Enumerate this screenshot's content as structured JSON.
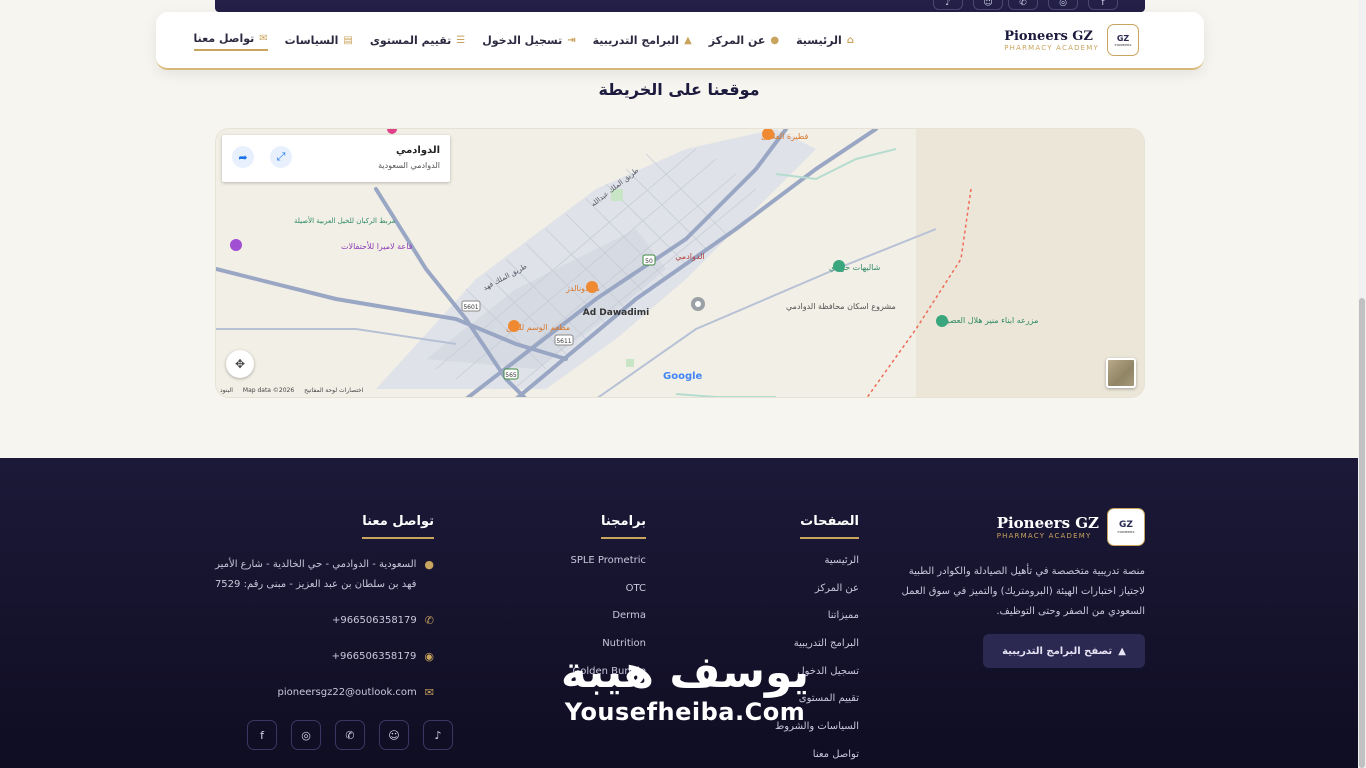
{
  "top_bar": {
    "socials": [
      {
        "icon": "facebook-icon",
        "glyph": "f"
      },
      {
        "icon": "instagram-icon",
        "glyph": "◎"
      },
      {
        "icon": "whatsapp-icon",
        "glyph": "✆"
      },
      {
        "icon": "snapchat-icon",
        "glyph": "☺"
      },
      {
        "icon": "tiktok-icon",
        "glyph": "♪"
      }
    ]
  },
  "brand": {
    "name": "Pioneers GZ",
    "subtitle": "PHARMACY ACADEMY",
    "logo_text": "GZ",
    "logo_sub": "PIONEERS"
  },
  "nav": [
    {
      "label": "الرئيسية",
      "icon": "home-icon",
      "glyph": "⌂"
    },
    {
      "label": "عن المركز",
      "icon": "info-icon",
      "glyph": "ⓘ"
    },
    {
      "label": "البرامج التدريبية",
      "icon": "graduation-cap-icon",
      "glyph": "🎓"
    },
    {
      "label": "تسجيل الدخول",
      "icon": "login-icon",
      "glyph": "⇥"
    },
    {
      "label": "تقييم المستوى",
      "icon": "checklist-icon",
      "glyph": "☷"
    },
    {
      "label": "السياسات",
      "icon": "file-icon",
      "glyph": "▤"
    },
    {
      "label": "تواصل معنا",
      "icon": "envelope-icon",
      "glyph": "✉",
      "active": true
    }
  ],
  "map_section": {
    "title": "موقعنا على الخريطة",
    "card_title": "الدوادمي",
    "card_subtitle": "الدوادمي السعودية",
    "labels": {
      "ad_dawadimi": "Ad Dawadimi",
      "dawadimi_ar": "الدوادمي",
      "mcdonalds": "ماكدونالدز",
      "falafel": "فطيرة الفلافل",
      "wasm": "مطعم الوسم للمتن",
      "housing": "مشروع اسكان محافظة الدوادمي",
      "chalets": "شاليهات حوادي",
      "farm": "مزرعه ابناء منير هلال العصيمي",
      "hall": "قاعة لاميرا للأحتفالات",
      "stable": "مربط الركبان للخيل العربية الأصيلة",
      "road_fahd": "طريق الملك فهد",
      "road_abdullah": "طريق الملك عبدالله",
      "shield_50": "50",
      "shield_5601": "5601",
      "shield_5611": "5611",
      "shield_565": "565"
    },
    "google": "Google",
    "map_data": "Map data ©2026",
    "shortcuts": "اختصارات لوحة المفاتيح",
    "terms": "البنود"
  },
  "footer": {
    "description": "منصة تدريبية متخصصة في تأهيل الصيادلة والكوادر الطبية لاجتياز اختبارات الهيئة (البرومتريك) والتميز في سوق العمل السعودي من الصفر وحتى التوظيف.",
    "browse_button": "تصفح البرامج التدريبية",
    "pages_title": "الصفحات",
    "pages": [
      "الرئيسية",
      "عن المركز",
      "مميزاتنا",
      "البرامج التدريبية",
      "تسجيل الدخول",
      "تقييم المستوى",
      "السياسات والشروط",
      "تواصل معنا"
    ],
    "programs_title": "برامجنا",
    "programs": [
      "SPLE Prometric",
      "OTC",
      "Derma",
      "Nutrition",
      "Golden Bundle"
    ],
    "contact_title": "تواصل معنا",
    "address": "السعودية - الدوادمي - حي الخالدية - شارع الأمير فهد بن سلطان بن عبد العزيز - مبنى رقم: 7529",
    "phone": "+966506358179",
    "whatsapp": "+966506358179",
    "email": "pioneersgz22@outlook.com",
    "socials": [
      {
        "icon": "facebook-icon",
        "glyph": "f"
      },
      {
        "icon": "instagram-icon",
        "glyph": "◎"
      },
      {
        "icon": "whatsapp-icon",
        "glyph": "✆"
      },
      {
        "icon": "snapchat-icon",
        "glyph": "☺"
      },
      {
        "icon": "tiktok-icon",
        "glyph": "♪"
      }
    ]
  },
  "watermark": {
    "arabic": "يوسف هيبة",
    "english": "Yousefheiba.Com"
  },
  "colors": {
    "gold": "#c9a45e",
    "navy": "#1c1a3d",
    "footer_bg": "#15132e"
  }
}
